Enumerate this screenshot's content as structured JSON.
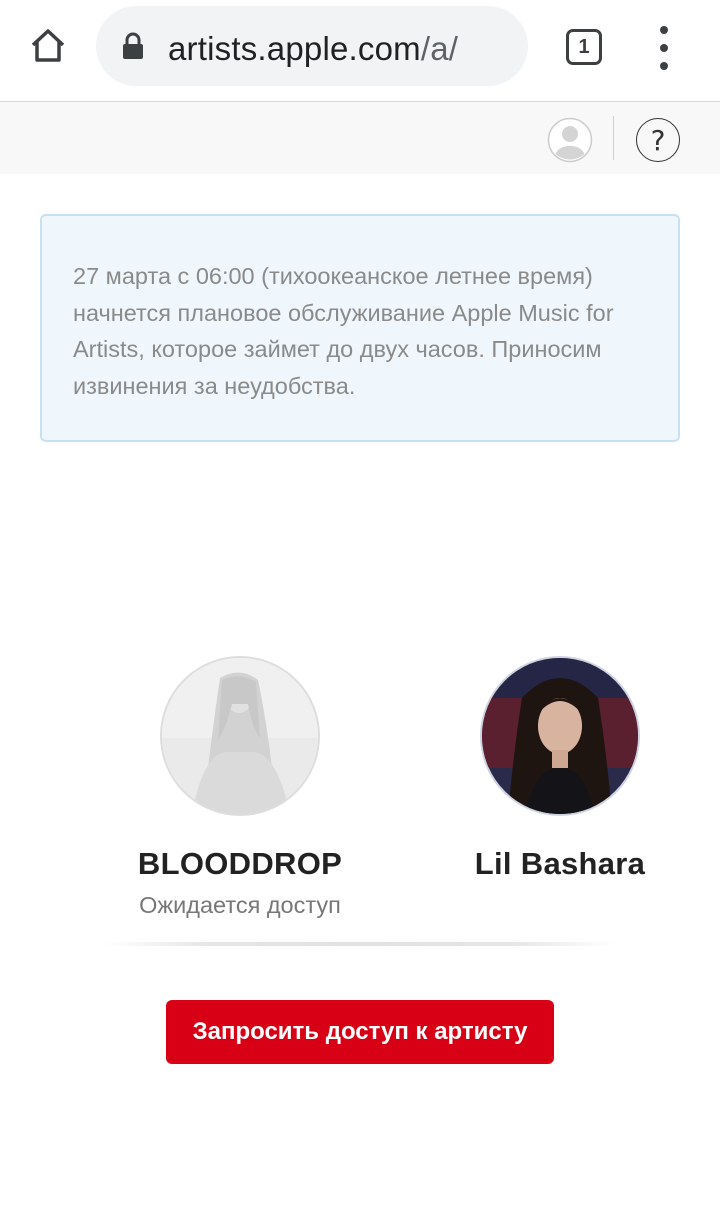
{
  "browser": {
    "url_host": "artists.apple.com",
    "url_path": "/a/",
    "tab_count": "1",
    "icons": {
      "home": "home-icon",
      "lock": "lock-icon",
      "menu": "kebab-menu-icon"
    }
  },
  "header": {
    "account_icon": "account-icon",
    "help_label": "?"
  },
  "notice": {
    "text": "27 марта с 06:00 (тихоокеанское летнее время) начнется плановое обслуживание Apple Music for Artists, которое займет до двух часов. Приносим извинения за неудобства."
  },
  "artists": [
    {
      "name": "BLOODDROP",
      "status": "Ожидается доступ"
    },
    {
      "name": "Lil Bashara",
      "status": ""
    }
  ],
  "actions": {
    "request_access_label": "Запросить доступ к артисту"
  },
  "colors": {
    "accent": "#d70015",
    "notice_bg": "#f0f7fc",
    "notice_border": "#c7e1f2"
  }
}
